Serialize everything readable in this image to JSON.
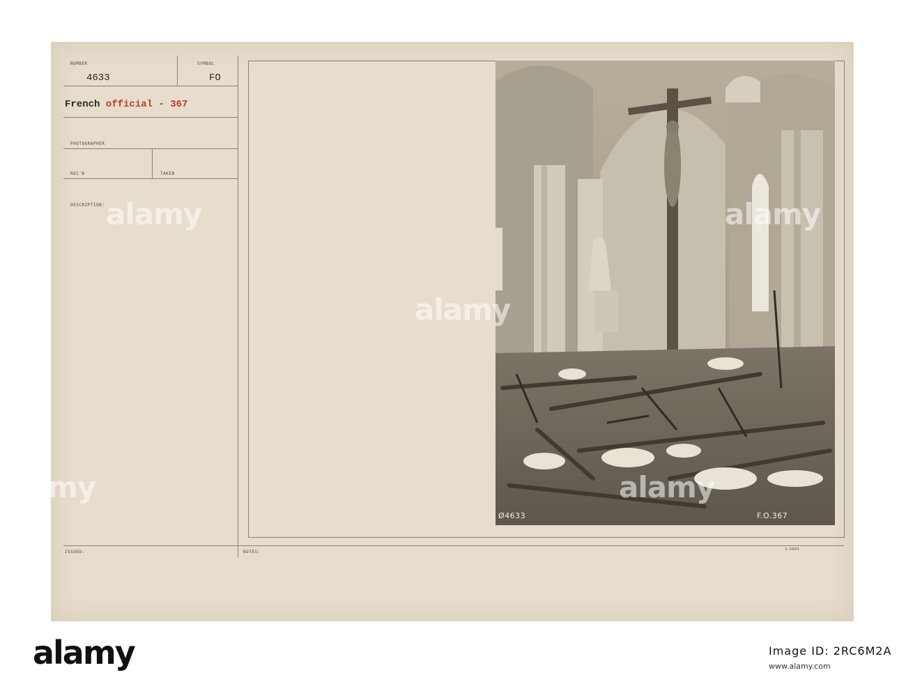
{
  "card": {
    "number_label": "NUMBER",
    "number_value": "4633",
    "symbol_label": "SYMBOL",
    "symbol_value": "FO",
    "source_prefix": "French",
    "source_main": "official - 367",
    "photographer_label": "PHOTOGRAPHER",
    "recd_label": "REC'D",
    "taken_label": "TAKEN",
    "description_label": "DESCRIPTION:",
    "issued_label": "ISSUED:",
    "notes_label": "NOTES:",
    "form_code": "3—5003"
  },
  "photo": {
    "left_code": "Ø4633",
    "right_code": "F.O.367"
  },
  "watermarks": [
    "alamy",
    "alamy",
    "alamy",
    "alamy",
    "alamy",
    "alamy"
  ],
  "footer": {
    "logo": "alamy",
    "image_id_label": "Image ID: 2RC6M2A",
    "url": "www.alamy.com"
  },
  "colors": {
    "card_background": "#e7ddcd",
    "photo_tone": "#bfb6a4",
    "typed_red": "#b83a2a"
  }
}
